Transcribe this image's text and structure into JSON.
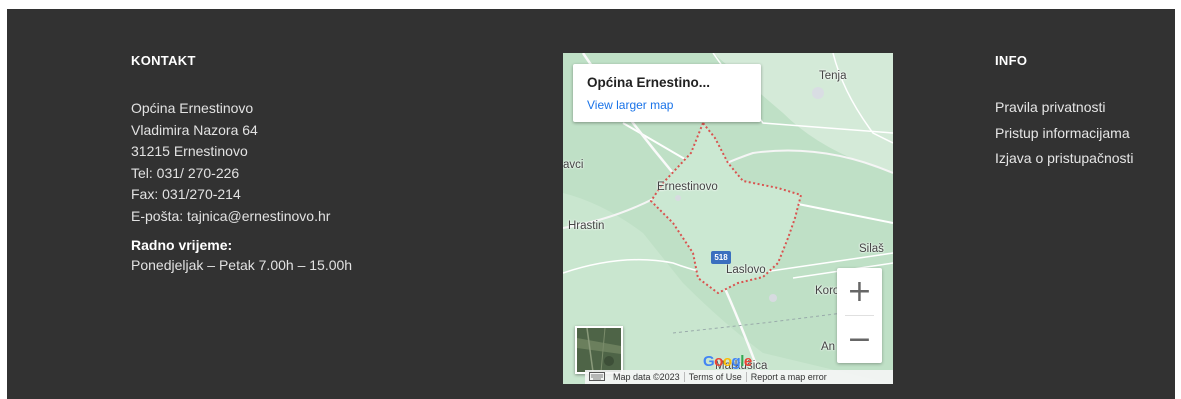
{
  "kontakt": {
    "title": "KONTAKT",
    "lines": [
      "Općina Ernestinovo",
      "Vladimira Nazora 64",
      "31215 Ernestinovo",
      "Tel: 031/ 270-226",
      "Fax: 031/270-214",
      "E-pošta: tajnica@ernestinovo.hr"
    ],
    "hours_title": "Radno vrijeme:",
    "hours": "Ponedjeljak – Petak 7.00h – 15.00h"
  },
  "map": {
    "card_title": "Općina Ernestino...",
    "view_larger": "View larger map",
    "labels": {
      "tenja": "Tenja",
      "avci": "avci",
      "ernestinovo": "Ernestinovo",
      "hrastin": "Hrastin",
      "silas": "Silaš",
      "laslovo": "Laslovo",
      "koro": "Koro",
      "an": "An",
      "markusica": "Markušica"
    },
    "road": "518",
    "logo": "Google",
    "zoom_in": "+",
    "zoom_out": "−",
    "attribution": {
      "data": "Map data ©2023",
      "terms": "Terms of Use",
      "report": "Report a map error"
    },
    "colors": {
      "land": "#bfe0c6",
      "boundary": "#d9534f",
      "link": "#1a73e8"
    }
  },
  "info": {
    "title": "INFO",
    "links": [
      "Pravila privatnosti",
      "Pristup informacijama",
      "Izjava o pristupačnosti"
    ]
  }
}
